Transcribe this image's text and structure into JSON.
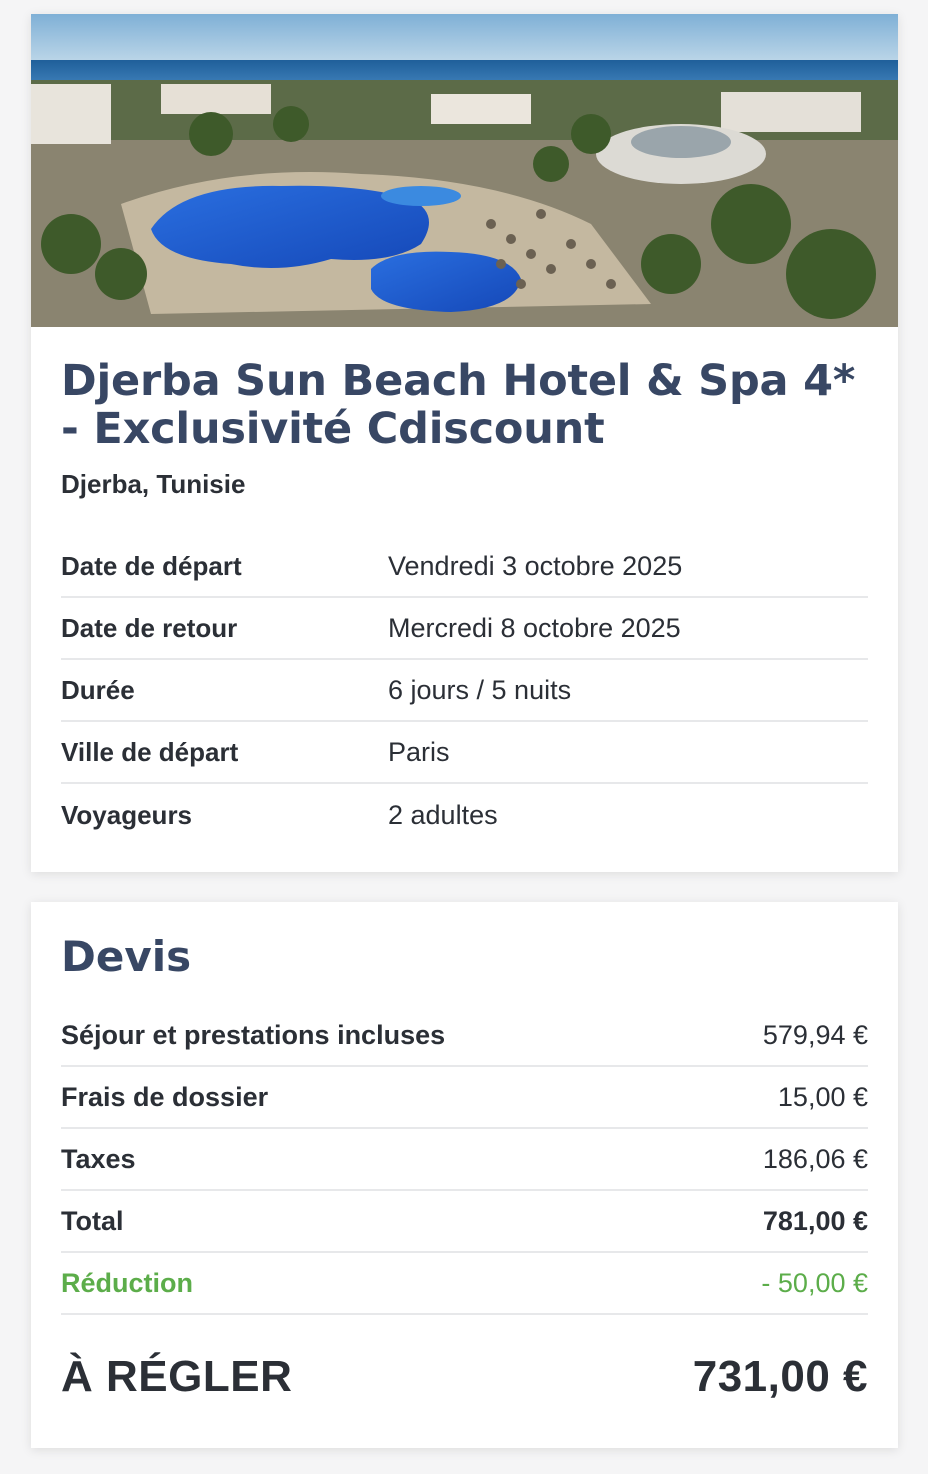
{
  "hotel": {
    "image_alt": "Vue aérienne de l'hôtel avec piscines et palmiers",
    "title": "Djerba Sun Beach Hotel & Spa 4* - Exclusivité Cdiscount",
    "location": "Djerba, Tunisie",
    "details": [
      {
        "label": "Date de départ",
        "value": "Vendredi 3 octobre 2025"
      },
      {
        "label": "Date de retour",
        "value": "Mercredi 8 octobre 2025"
      },
      {
        "label": "Durée",
        "value": "6 jours / 5 nuits"
      },
      {
        "label": "Ville de départ",
        "value": "Paris"
      },
      {
        "label": "Voyageurs",
        "value": "2 adultes"
      }
    ]
  },
  "quote": {
    "title": "Devis",
    "lines": [
      {
        "label": "Séjour et prestations incluses",
        "value": "579,94 €"
      },
      {
        "label": "Frais de dossier",
        "value": "15,00 €"
      },
      {
        "label": "Taxes",
        "value": "186,06 €"
      },
      {
        "label": "Total",
        "value": "781,00 €"
      },
      {
        "label": "Réduction",
        "value": "- 50,00 €"
      }
    ],
    "grand_label": "À RÉGLER",
    "grand_value": "731,00 €"
  },
  "colors": {
    "title": "#384764",
    "text": "#2b2f36",
    "discount": "#5cad4a",
    "divider": "#e7e8ea"
  }
}
